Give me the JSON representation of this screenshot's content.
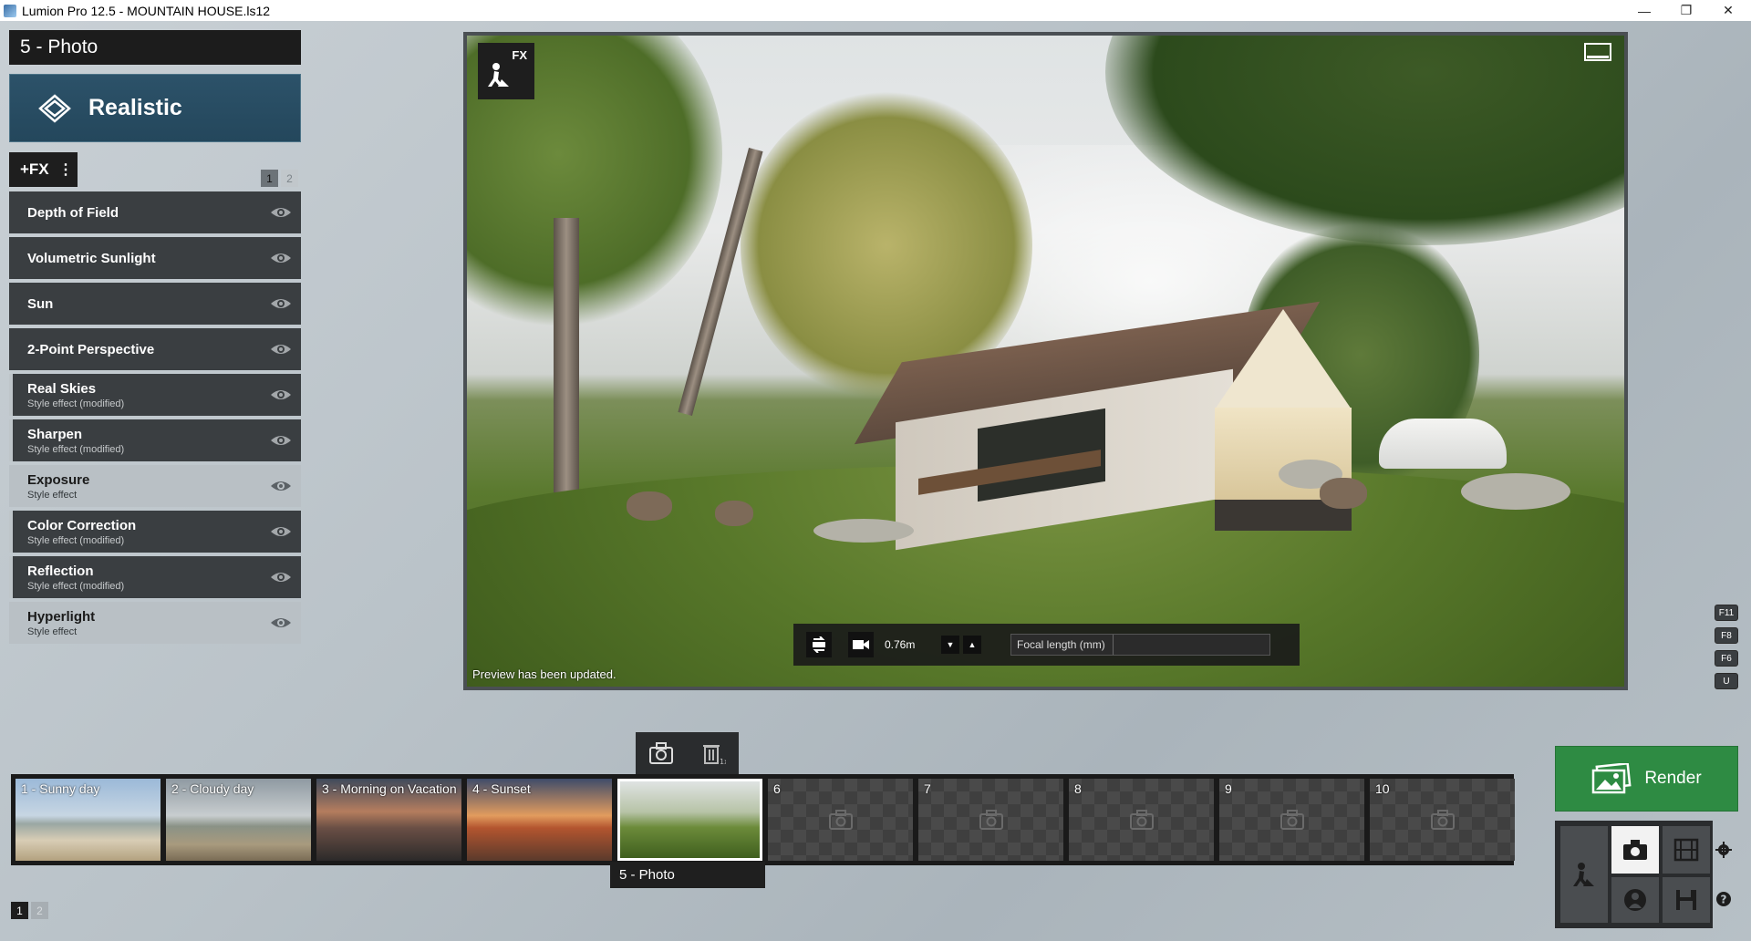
{
  "window": {
    "title": "Lumion Pro 12.5 - MOUNTAIN HOUSE.ls12",
    "minimize": "—",
    "restore": "❐",
    "close": "✕"
  },
  "left_panel": {
    "photo_title": "5 - Photo",
    "style_label": "Realistic",
    "add_fx_label": "+FX",
    "add_fx_menu": "⋮",
    "pages": [
      "1",
      "2"
    ],
    "effects": [
      {
        "name": "Depth of Field",
        "subtitle": "",
        "variant": "dark"
      },
      {
        "name": "Volumetric Sunlight",
        "subtitle": "",
        "variant": "dark"
      },
      {
        "name": "Sun",
        "subtitle": "",
        "variant": "dark"
      },
      {
        "name": "2-Point Perspective",
        "subtitle": "",
        "variant": "dark"
      },
      {
        "name": "Real Skies",
        "subtitle": "Style effect (modified)",
        "variant": "styled"
      },
      {
        "name": "Sharpen",
        "subtitle": "Style effect (modified)",
        "variant": "styled"
      },
      {
        "name": "Exposure",
        "subtitle": "Style effect",
        "variant": "light"
      },
      {
        "name": "Color Correction",
        "subtitle": "Style effect (modified)",
        "variant": "styled"
      },
      {
        "name": "Reflection",
        "subtitle": "Style effect (modified)",
        "variant": "styled"
      },
      {
        "name": "Hyperlight",
        "subtitle": "Style effect",
        "variant": "light"
      }
    ]
  },
  "viewport": {
    "fx_badge": "FX",
    "preview_message": "Preview has been updated.",
    "camera_height": "0.76m",
    "focal_placeholder": "Focal length (mm)",
    "down_arrow": "▼",
    "up_arrow": "▲"
  },
  "hotkeys": [
    "F11",
    "F8",
    "F6",
    "U"
  ],
  "photo_strip": {
    "slots": [
      {
        "label": "1 - Sunny day",
        "state": "filled"
      },
      {
        "label": "2 - Cloudy day",
        "state": "filled"
      },
      {
        "label": "3 - Morning on Vacation",
        "state": "filled"
      },
      {
        "label": "4 - Sunset",
        "state": "filled"
      },
      {
        "label": "",
        "state": "active"
      },
      {
        "label": "6",
        "state": "empty"
      },
      {
        "label": "7",
        "state": "empty"
      },
      {
        "label": "8",
        "state": "empty"
      },
      {
        "label": "9",
        "state": "empty"
      },
      {
        "label": "10",
        "state": "empty"
      }
    ],
    "active_caption": "5 - Photo",
    "pages": [
      "1",
      "2"
    ]
  },
  "render": {
    "label": "Render"
  },
  "colors": {
    "render_green": "#2e8b43",
    "style_blue": "#2c5269",
    "panel_dark": "#3a3e41"
  }
}
